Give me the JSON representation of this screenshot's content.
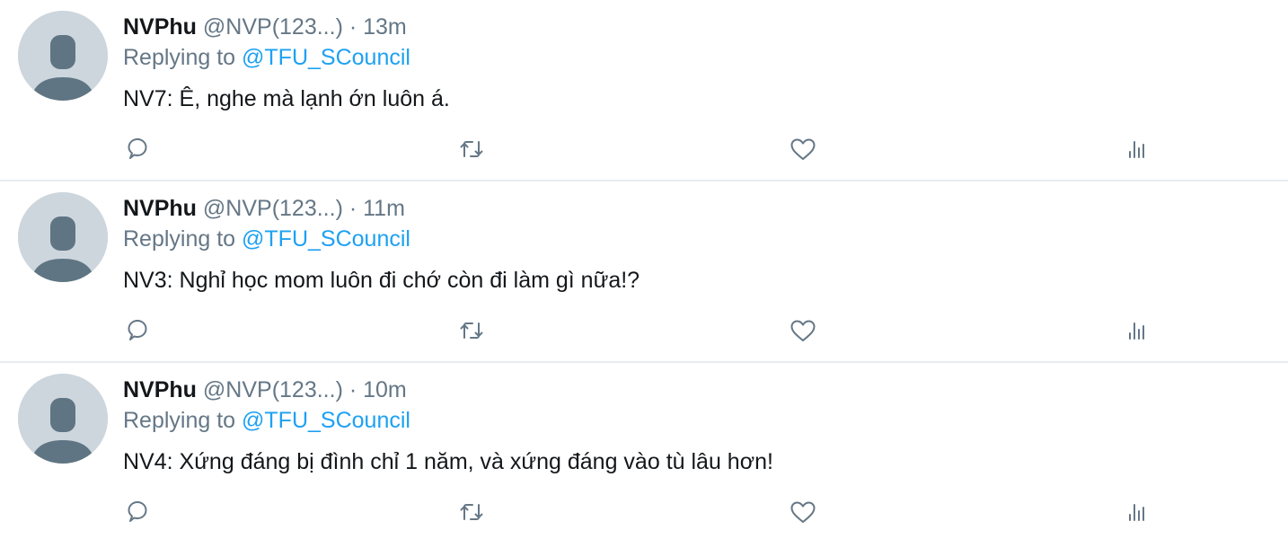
{
  "colors": {
    "link": "#1da1f2",
    "muted": "#657786",
    "text": "#14171a",
    "avatar_bg": "#cdd6dd",
    "avatar_fg": "#5f7583",
    "divider": "#e6ecf0"
  },
  "icons": {
    "avatar": "default-avatar-icon",
    "reply": "reply-icon",
    "retweet": "retweet-icon",
    "like": "heart-icon",
    "analytics": "analytics-icon"
  },
  "tweets": [
    {
      "display_name": "NVPhu",
      "handle": "@NVP(123...)",
      "separator": "·",
      "time": "13m",
      "replying_prefix": "Replying to ",
      "replying_to": "@TFU_SCouncil",
      "text": "NV7: Ê, nghe mà lạnh ớn luôn á."
    },
    {
      "display_name": "NVPhu",
      "handle": "@NVP(123...)",
      "separator": "·",
      "time": "11m",
      "replying_prefix": "Replying to ",
      "replying_to": "@TFU_SCouncil",
      "text": "NV3: Nghỉ học mom luôn đi chớ còn đi làm gì nữa!?"
    },
    {
      "display_name": "NVPhu",
      "handle": "@NVP(123...)",
      "separator": "·",
      "time": "10m",
      "replying_prefix": "Replying to ",
      "replying_to": "@TFU_SCouncil",
      "text": "NV4: Xứng đáng bị đình chỉ 1 năm, và xứng đáng vào tù lâu hơn!"
    }
  ]
}
